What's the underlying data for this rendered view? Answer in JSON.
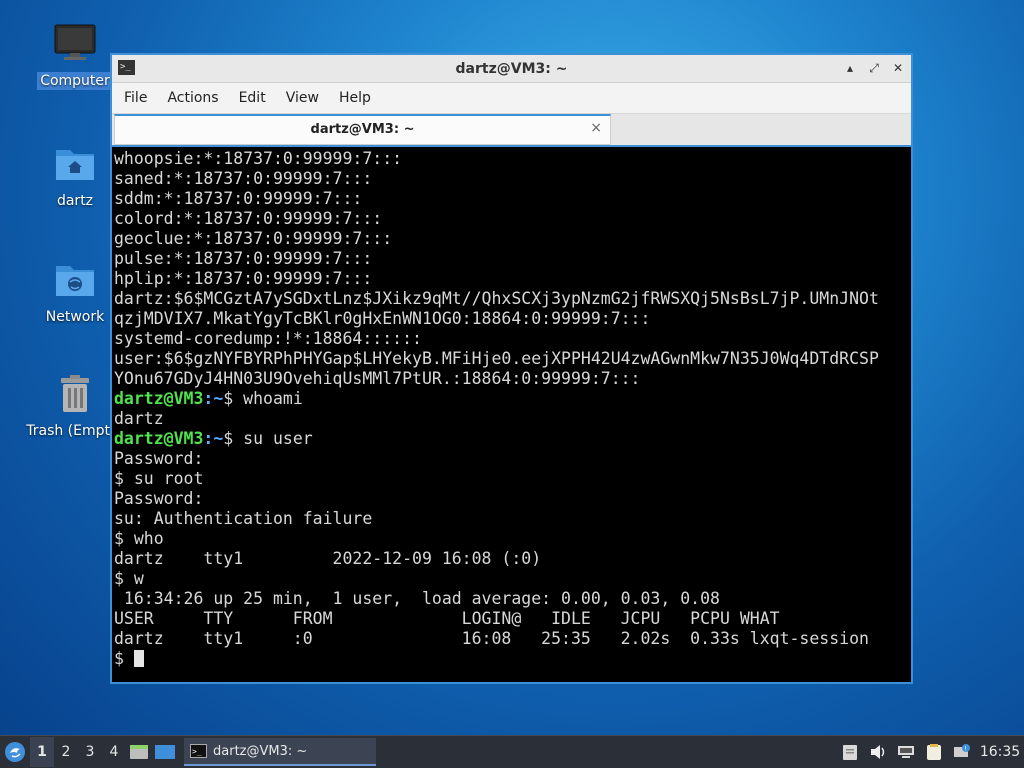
{
  "desktop": {
    "icons": [
      {
        "label": "Computer",
        "icon": "monitor-icon"
      },
      {
        "label": "dartz",
        "icon": "home-folder-icon"
      },
      {
        "label": "Network",
        "icon": "network-folder-icon"
      },
      {
        "label": "Trash (Empty)",
        "icon": "trash-icon"
      }
    ]
  },
  "window": {
    "title": "dartz@VM3: ~",
    "menu": [
      "File",
      "Actions",
      "Edit",
      "View",
      "Help"
    ],
    "tab_label": "dartz@VM3: ~",
    "tab_close": "×",
    "controls": {
      "minimize": "▴",
      "maximize": "⤢",
      "close": "✕"
    }
  },
  "terminal": {
    "lines": [
      {
        "text": "whoopsie:*:18737:0:99999:7:::"
      },
      {
        "text": "saned:*:18737:0:99999:7:::"
      },
      {
        "text": "sddm:*:18737:0:99999:7:::"
      },
      {
        "text": "colord:*:18737:0:99999:7:::"
      },
      {
        "text": "geoclue:*:18737:0:99999:7:::"
      },
      {
        "text": "pulse:*:18737:0:99999:7:::"
      },
      {
        "text": "hplip:*:18737:0:99999:7:::"
      },
      {
        "text": "dartz:$6$MCGztA7ySGDxtLnz$JXikz9qMt//QhxSCXj3ypNzmG2jfRWSXQj5NsBsL7jP.UMnJNOt"
      },
      {
        "text": "qzjMDVIX7.MkatYgyTcBKlr0gHxEnWN1OG0:18864:0:99999:7:::"
      },
      {
        "text": "systemd-coredump:!*:18864::::::"
      },
      {
        "text": "user:$6$gzNYFBYRPhPHYGap$LHYekyB.MFiHje0.eejXPPH42U4zwAGwnMkw7N35J0Wq4DTdRCSP"
      },
      {
        "text": "YOnu67GDyJ4HN03U9OvehiqUsMMl7PtUR.:18864:0:99999:7:::"
      },
      {
        "prompt_user": "dartz@VM3",
        "prompt_path": ":~",
        "text": "$ whoami"
      },
      {
        "text": "dartz"
      },
      {
        "prompt_user": "dartz@VM3",
        "prompt_path": ":~",
        "text": "$ su user"
      },
      {
        "text": "Password:"
      },
      {
        "text": "$ su root"
      },
      {
        "text": "Password:"
      },
      {
        "text": "su: Authentication failure"
      },
      {
        "text": "$ who"
      },
      {
        "text": "dartz    tty1         2022-12-09 16:08 (:0)"
      },
      {
        "text": "$ w"
      },
      {
        "text": " 16:34:26 up 25 min,  1 user,  load average: 0.00, 0.03, 0.08"
      },
      {
        "text": "USER     TTY      FROM             LOGIN@   IDLE   JCPU   PCPU WHAT"
      },
      {
        "text": "dartz    tty1     :0               16:08   25:35   2.02s  0.33s lxqt-session"
      },
      {
        "text": "$ ",
        "cursor": true
      }
    ]
  },
  "taskbar": {
    "desktops": [
      "1",
      "2",
      "3",
      "4"
    ],
    "active_desktop": "1",
    "task_label": "dartz@VM3: ~",
    "clock": "16:35"
  },
  "colors": {
    "accent": "#3d8fd6",
    "prompt_user": "#4fe34f",
    "prompt_path": "#5ab0ff",
    "terminal_bg": "#000000",
    "taskbar_bg": "#2b2f37"
  }
}
